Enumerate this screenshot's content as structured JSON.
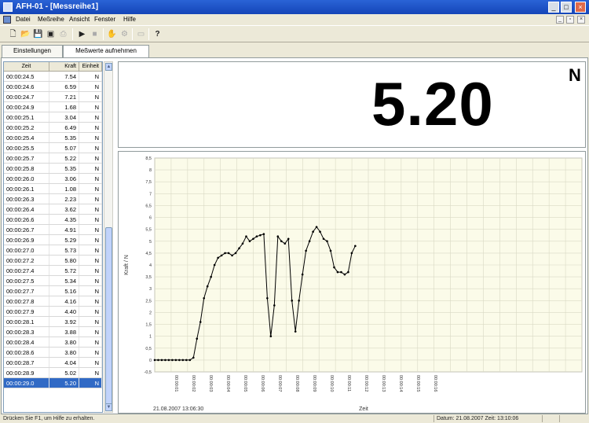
{
  "window": {
    "title": "AFH-01 - [Messreihe1]"
  },
  "menubar": {
    "items": [
      "Datei",
      "Meßreihe",
      "Ansicht",
      "Fenster",
      "Hilfe"
    ]
  },
  "tabs": [
    {
      "label": "Einstellungen"
    },
    {
      "label": "Meßwerte aufnehmen"
    }
  ],
  "table": {
    "headers": [
      "Zeit",
      "Kraft",
      "Einheit"
    ],
    "rows": [
      [
        "00:00:24.5",
        "7.54",
        "N"
      ],
      [
        "00:00:24.6",
        "6.59",
        "N"
      ],
      [
        "00:00:24.7",
        "7.21",
        "N"
      ],
      [
        "00:00:24.9",
        "1.68",
        "N"
      ],
      [
        "00:00:25.1",
        "3.04",
        "N"
      ],
      [
        "00:00:25.2",
        "6.49",
        "N"
      ],
      [
        "00:00:25.4",
        "5.35",
        "N"
      ],
      [
        "00:00:25.5",
        "5.07",
        "N"
      ],
      [
        "00:00:25.7",
        "5.22",
        "N"
      ],
      [
        "00:00:25.8",
        "5.35",
        "N"
      ],
      [
        "00:00:26.0",
        "3.06",
        "N"
      ],
      [
        "00:00:26.1",
        "1.08",
        "N"
      ],
      [
        "00:00:26.3",
        "2.23",
        "N"
      ],
      [
        "00:00:26.4",
        "3.62",
        "N"
      ],
      [
        "00:00:26.6",
        "4.35",
        "N"
      ],
      [
        "00:00:26.7",
        "4.91",
        "N"
      ],
      [
        "00:00:26.9",
        "5.29",
        "N"
      ],
      [
        "00:00:27.0",
        "5.73",
        "N"
      ],
      [
        "00:00:27.2",
        "5.80",
        "N"
      ],
      [
        "00:00:27.4",
        "5.72",
        "N"
      ],
      [
        "00:00:27.5",
        "5.34",
        "N"
      ],
      [
        "00:00:27.7",
        "5.16",
        "N"
      ],
      [
        "00:00:27.8",
        "4.16",
        "N"
      ],
      [
        "00:00:27.9",
        "4.40",
        "N"
      ],
      [
        "00:00:28.1",
        "3.92",
        "N"
      ],
      [
        "00:00:28.3",
        "3.88",
        "N"
      ],
      [
        "00:00:28.4",
        "3.80",
        "N"
      ],
      [
        "00:00:28.6",
        "3.80",
        "N"
      ],
      [
        "00:00:28.7",
        "4.04",
        "N"
      ],
      [
        "00:00:28.9",
        "5.02",
        "N"
      ],
      [
        "00:00:29.0",
        "5.20",
        "N"
      ]
    ],
    "selected_index": 30
  },
  "display": {
    "value": "5.20",
    "unit": "N"
  },
  "chart_data": {
    "type": "line",
    "ylabel": "Kraft / N",
    "xlabel": "Zeit",
    "start_label": "21.08.2007 13:06:30",
    "ylim": [
      -0.5,
      8.5
    ],
    "yticks": [
      "8,5",
      "8",
      "7,5",
      "7",
      "6,5",
      "6",
      "5,5",
      "5",
      "4,5",
      "4",
      "3,5",
      "3",
      "2,5",
      "2",
      "1,5",
      "1",
      "0,5",
      "0",
      "-0,5"
    ],
    "xticks": [
      "00:00:01",
      "00:00:02",
      "00:00:03",
      "00:00:04",
      "00:00:05",
      "00:00:06",
      "00:00:07",
      "00:00:08",
      "00:00:09",
      "00:00:10",
      "00:00:11",
      "00:00:12",
      "00:00:13",
      "00:00:14",
      "00:00:15",
      "00:00:16"
    ],
    "series": [
      {
        "color": "#000000",
        "values": [
          0,
          0,
          0,
          0,
          0,
          0,
          0,
          0,
          0,
          0,
          0,
          0.1,
          0.9,
          1.6,
          2.6,
          3.1,
          3.5,
          4.0,
          4.3,
          4.4,
          4.5,
          4.5,
          4.4,
          4.5,
          4.7,
          4.9,
          5.2,
          5.0,
          5.1,
          5.2,
          5.25,
          5.3,
          2.6,
          1.0,
          2.3,
          5.2,
          5.0,
          4.9,
          5.1,
          2.5,
          1.2,
          2.5,
          3.6,
          4.6,
          5.0,
          5.4,
          5.6,
          5.4,
          5.1,
          5.0,
          4.6,
          3.9,
          3.7,
          3.7,
          3.6,
          3.7,
          4.5,
          4.8
        ]
      }
    ]
  },
  "statusbar": {
    "help": "Drücken Sie F1, um Hilfe zu erhalten.",
    "datetime": "Datum: 21.08.2007 Zeit: 13:10:06"
  }
}
